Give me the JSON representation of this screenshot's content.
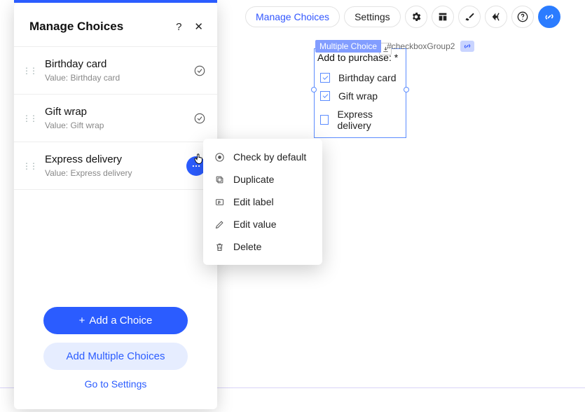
{
  "toolbar": {
    "manage": "Manage Choices",
    "settings": "Settings"
  },
  "canvas": {
    "badge_name": "Multiple Choice",
    "badge_id": "#checkboxGroup2",
    "title": "Add to purchase: *",
    "options": [
      {
        "label": "Birthday card",
        "checked": true
      },
      {
        "label": "Gift wrap",
        "checked": true
      },
      {
        "label": "Express delivery",
        "checked": false
      }
    ]
  },
  "panel": {
    "title": "Manage Choices",
    "help": "?",
    "value_prefix": "Value: ",
    "choices": [
      {
        "label": "Birthday card",
        "value": "Birthday card"
      },
      {
        "label": "Gift wrap",
        "value": "Gift wrap"
      },
      {
        "label": "Express delivery",
        "value": "Express delivery"
      }
    ],
    "add": "Add a Choice",
    "add_multiple": "Add Multiple Choices",
    "go_settings": "Go to Settings"
  },
  "ctx": {
    "check_default": "Check by default",
    "duplicate": "Duplicate",
    "edit_label": "Edit label",
    "edit_value": "Edit value",
    "delete": "Delete"
  }
}
